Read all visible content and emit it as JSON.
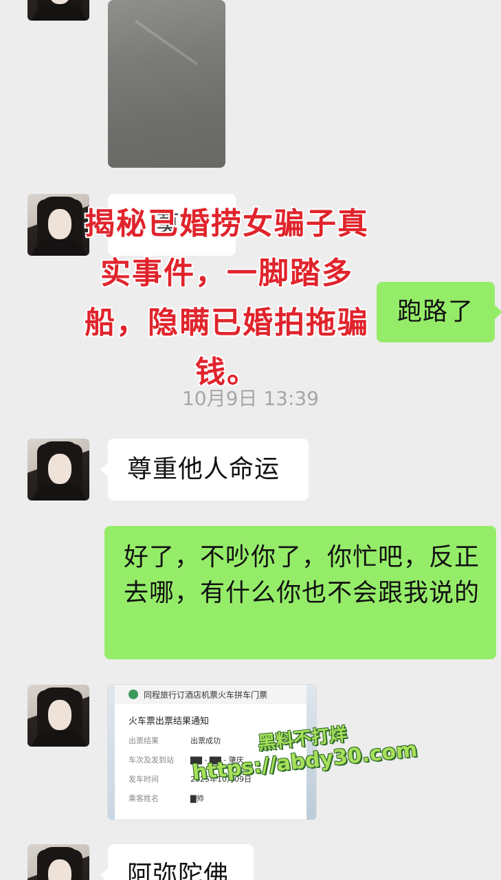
{
  "messages": {
    "m1_partial": "莫收",
    "m2": "跑路了",
    "m3": "尊重他人命运",
    "m4": "好了，不吵你了，你忙吧，反正去哪，有什么你也不会跟我说的",
    "m5": "阿弥陀佛"
  },
  "timestamp": "10月9日 13:39",
  "overlay": {
    "line1": "揭秘已婚捞女骗子真",
    "line2": "实事件，一脚踏多",
    "line3": "船，隐瞒已婚拍拖骗",
    "line4": "钱。"
  },
  "ticket": {
    "header": "同程旅行订酒店机票火车拼车门票",
    "title": "火车票出票结果通知",
    "rows": [
      {
        "k": "出票结果",
        "v": "出票成功"
      },
      {
        "k": "车次及发到站",
        "v": "▇▇ - ▇▇ - 肇庆"
      },
      {
        "k": "发车时间",
        "v": "2025年10月09日"
      },
      {
        "k": "乘客姓名",
        "v": "▇帅"
      }
    ]
  },
  "watermark": {
    "line1": "黑料不打烊",
    "line2": "https://abdy30.com"
  },
  "colors": {
    "background": "#ededed",
    "bubble_green": "#95ec69",
    "bubble_white": "#ffffff",
    "overlay_red": "#e0242c"
  }
}
